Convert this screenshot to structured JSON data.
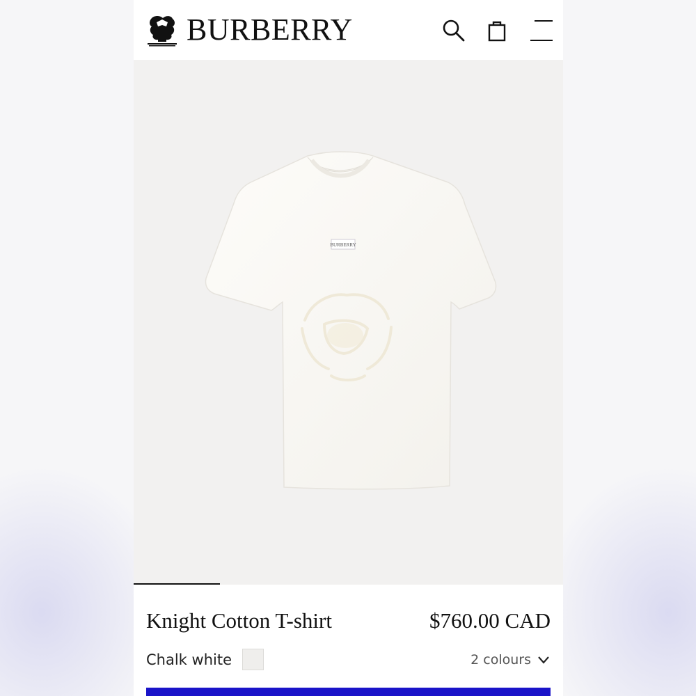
{
  "header": {
    "brand": "BURBERRY",
    "icons": [
      "burberry-crest-logo",
      "search-icon",
      "shopping-bag-icon",
      "menu-icon"
    ]
  },
  "gallery": {
    "product_image": "knight-cotton-t-shirt-chalk-white",
    "image_position": "1",
    "label_print": "BURBERRY"
  },
  "product": {
    "name": "Knight Cotton T-shirt",
    "price": "$760.00 CAD",
    "colour_name": "Chalk white",
    "colour_count": "2 colours"
  },
  "colors": {
    "accent": "#1a14c9",
    "swatch": "#efeeec",
    "image_bg": "#f2f1f0"
  }
}
